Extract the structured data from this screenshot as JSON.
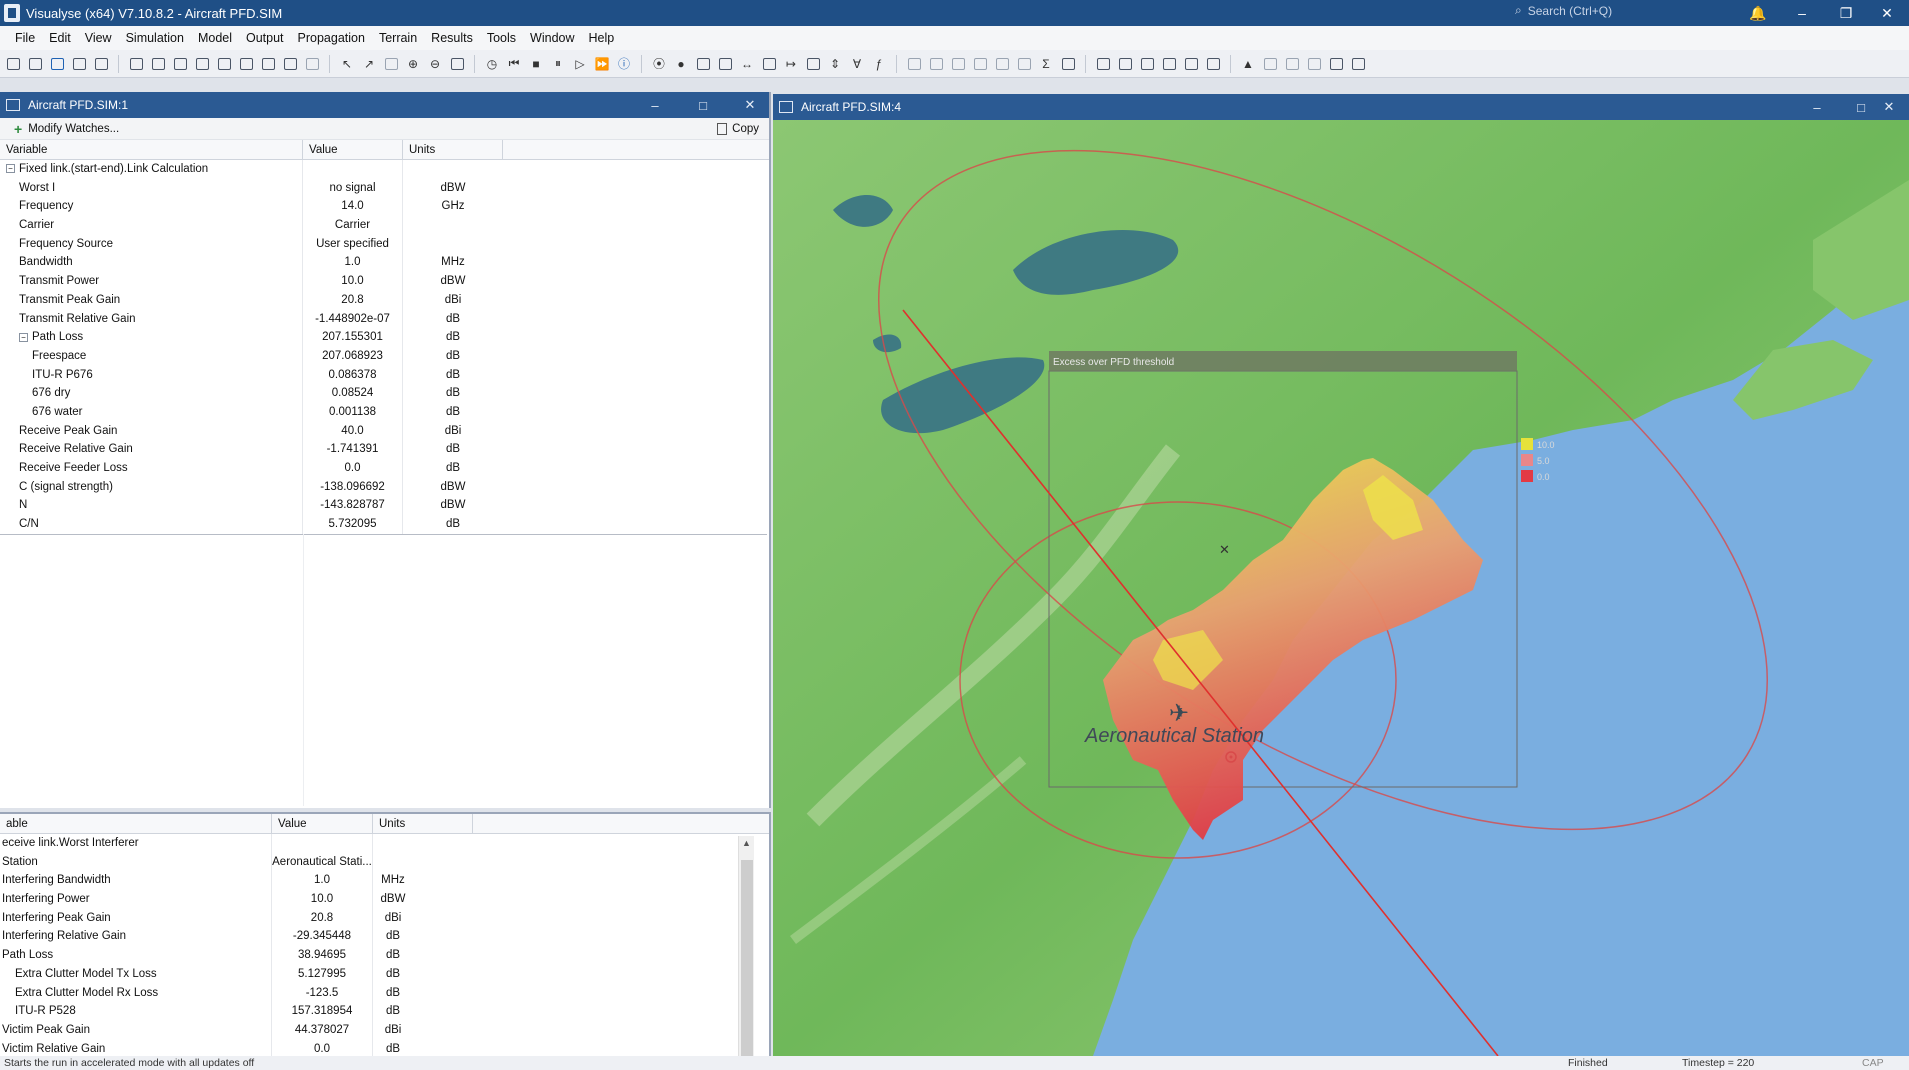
{
  "app": {
    "title": "Visualyse (x64) V7.10.8.2 - Aircraft PFD.SIM",
    "search_placeholder": "Search (Ctrl+Q)"
  },
  "menu": [
    "File",
    "Edit",
    "View",
    "Simulation",
    "Model",
    "Output",
    "Propagation",
    "Terrain",
    "Results",
    "Tools",
    "Window",
    "Help"
  ],
  "left_window": {
    "title": "Aircraft PFD.SIM:1",
    "modify_watches": "Modify Watches...",
    "copy": "Copy",
    "columns": [
      "Variable",
      "Value",
      "Units"
    ],
    "rows": [
      {
        "indent": 0,
        "toggle": "−",
        "name": "Fixed link.(start-end).Link Calculation",
        "value": "",
        "units": ""
      },
      {
        "indent": 1,
        "name": "Worst I",
        "value": "no signal",
        "units": "dBW"
      },
      {
        "indent": 1,
        "name": "Frequency",
        "value": "14.0",
        "units": "GHz"
      },
      {
        "indent": 1,
        "name": "Carrier",
        "value": "Carrier",
        "units": ""
      },
      {
        "indent": 1,
        "name": "Frequency Source",
        "value": "User specified",
        "units": ""
      },
      {
        "indent": 1,
        "name": "Bandwidth",
        "value": "1.0",
        "units": "MHz"
      },
      {
        "indent": 1,
        "name": "Transmit Power",
        "value": "10.0",
        "units": "dBW"
      },
      {
        "indent": 1,
        "name": "Transmit Peak Gain",
        "value": "20.8",
        "units": "dBi"
      },
      {
        "indent": 1,
        "name": "Transmit Relative Gain",
        "value": "-1.448902e-07",
        "units": "dB"
      },
      {
        "indent": 1,
        "toggle": "−",
        "name": "Path Loss",
        "value": "207.155301",
        "units": "dB"
      },
      {
        "indent": 2,
        "name": "Freespace",
        "value": "207.068923",
        "units": "dB"
      },
      {
        "indent": 2,
        "name": "ITU-R P676",
        "value": "0.086378",
        "units": "dB"
      },
      {
        "indent": 2,
        "name": "676 dry",
        "value": "0.08524",
        "units": "dB"
      },
      {
        "indent": 2,
        "name": "676 water",
        "value": "0.001138",
        "units": "dB"
      },
      {
        "indent": 1,
        "name": "Receive Peak Gain",
        "value": "40.0",
        "units": "dBi"
      },
      {
        "indent": 1,
        "name": "Receive Relative Gain",
        "value": "-1.741391",
        "units": "dB"
      },
      {
        "indent": 1,
        "name": "Receive Feeder Loss",
        "value": "0.0",
        "units": "dB"
      },
      {
        "indent": 1,
        "name": "C (signal strength)",
        "value": "-138.096692",
        "units": "dBW"
      },
      {
        "indent": 1,
        "name": "N",
        "value": "-143.828787",
        "units": "dBW"
      },
      {
        "indent": 1,
        "name": "C/N",
        "value": "5.732095",
        "units": "dB"
      }
    ]
  },
  "bottom_pane": {
    "columns": [
      "able",
      "Value",
      "Units"
    ],
    "rows": [
      {
        "indent": 0,
        "name": "eceive link.Worst Interferer",
        "value": "",
        "units": ""
      },
      {
        "indent": 0,
        "name": "Station",
        "value": "Aeronautical Stati...",
        "units": ""
      },
      {
        "indent": 0,
        "name": "Interfering Bandwidth",
        "value": "1.0",
        "units": "MHz"
      },
      {
        "indent": 0,
        "name": "Interfering Power",
        "value": "10.0",
        "units": "dBW"
      },
      {
        "indent": 0,
        "name": "Interfering Peak Gain",
        "value": "20.8",
        "units": "dBi"
      },
      {
        "indent": 0,
        "name": "Interfering Relative Gain",
        "value": "-29.345448",
        "units": "dB"
      },
      {
        "indent": 0,
        "name": "Path Loss",
        "value": "38.94695",
        "units": "dB"
      },
      {
        "indent": 1,
        "name": "Extra Clutter Model Tx Loss",
        "value": "5.127995",
        "units": "dB"
      },
      {
        "indent": 1,
        "name": "Extra Clutter Model Rx Loss",
        "value": "-123.5",
        "units": "dB"
      },
      {
        "indent": 1,
        "name": "ITU-R P528",
        "value": "157.318954",
        "units": "dB"
      },
      {
        "indent": 0,
        "name": "Victim Peak Gain",
        "value": "44.378027",
        "units": "dBi"
      },
      {
        "indent": 0,
        "name": "Victim Relative Gain",
        "value": "0.0",
        "units": "dB"
      }
    ]
  },
  "map_window": {
    "title": "Aircraft PFD.SIM:4",
    "overlay_title": "Excess over PFD threshold",
    "legend": [
      {
        "label": "10.0",
        "color": "#e6e23a"
      },
      {
        "label": "5.0",
        "color": "#e8868a"
      },
      {
        "label": "0.0",
        "color": "#e33a44"
      }
    ],
    "station_label": "Aeronautical Station"
  },
  "statusbar": {
    "message": "Starts the run in accelerated mode with all updates off",
    "state": "Finished",
    "timestep": "Timestep = 220",
    "indicators": "CAP NUM"
  },
  "colors": {
    "title_bar": "#1f4f86",
    "window_title": "#2b5a93",
    "ocean": "#7aaee0",
    "land": "#7fc36a",
    "circle": "#d84a4a"
  }
}
